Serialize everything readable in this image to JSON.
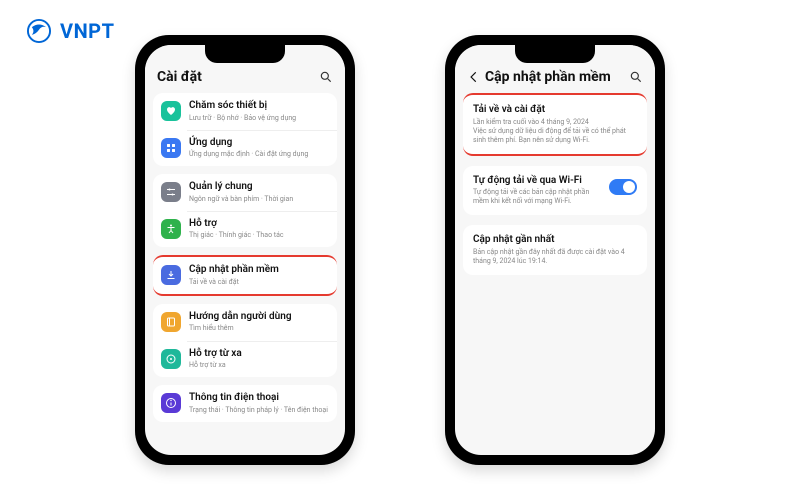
{
  "brand": {
    "name": "VNPT"
  },
  "phone1": {
    "header": {
      "title": "Cài đặt"
    },
    "groups": [
      {
        "rows": [
          {
            "icon": "heart",
            "bg": "#19c29b",
            "title": "Chăm sóc thiết bị",
            "sub": "Lưu trữ · Bộ nhớ · Bảo vệ ứng dụng"
          },
          {
            "icon": "grid",
            "bg": "#3a78f2",
            "title": "Ứng dụng",
            "sub": "Ứng dụng mặc định · Cài đặt ứng dụng"
          }
        ]
      },
      {
        "rows": [
          {
            "icon": "sliders",
            "bg": "#7a7e8a",
            "title": "Quản lý chung",
            "sub": "Ngôn ngữ và bàn phím · Thời gian"
          },
          {
            "icon": "accessibility",
            "bg": "#2fb24c",
            "title": "Hỗ trợ",
            "sub": "Thị giác · Thính giác · Thao tác"
          }
        ]
      },
      {
        "highlight": true,
        "rows": [
          {
            "icon": "download",
            "bg": "#4a6be0",
            "title": "Cập nhật phần mềm",
            "sub": "Tải về và cài đặt"
          }
        ]
      },
      {
        "rows": [
          {
            "icon": "book",
            "bg": "#f0a62f",
            "title": "Hướng dẫn người dùng",
            "sub": "Tìm hiểu thêm"
          },
          {
            "icon": "remote",
            "bg": "#1fb89a",
            "title": "Hỗ trợ từ xa",
            "sub": "Hỗ trợ từ xa"
          }
        ]
      },
      {
        "rows": [
          {
            "icon": "info",
            "bg": "#5a3ad6",
            "title": "Thông tin điện thoại",
            "sub": "Trạng thái · Thông tin pháp lý · Tên điện thoại"
          }
        ]
      }
    ]
  },
  "phone2": {
    "header": {
      "title": "Cập nhật phần mềm"
    },
    "items": [
      {
        "highlight": true,
        "title": "Tải về và cài đặt",
        "sub": "Lần kiểm tra cuối vào 4 tháng 9, 2024\nViệc sử dụng dữ liệu di động để tải về có thể phát sinh thêm phí. Bạn nên sử dụng Wi-Fi."
      },
      {
        "toggle": true,
        "title": "Tự động tải về qua Wi-Fi",
        "sub": "Tự động tải về các bản cập nhật phần mềm khi kết nối với mạng Wi-Fi."
      },
      {
        "title": "Cập nhật gần nhất",
        "sub": "Bản cập nhật gần đây nhất đã được cài đặt vào 4 tháng 9, 2024 lúc 19:14."
      }
    ]
  }
}
